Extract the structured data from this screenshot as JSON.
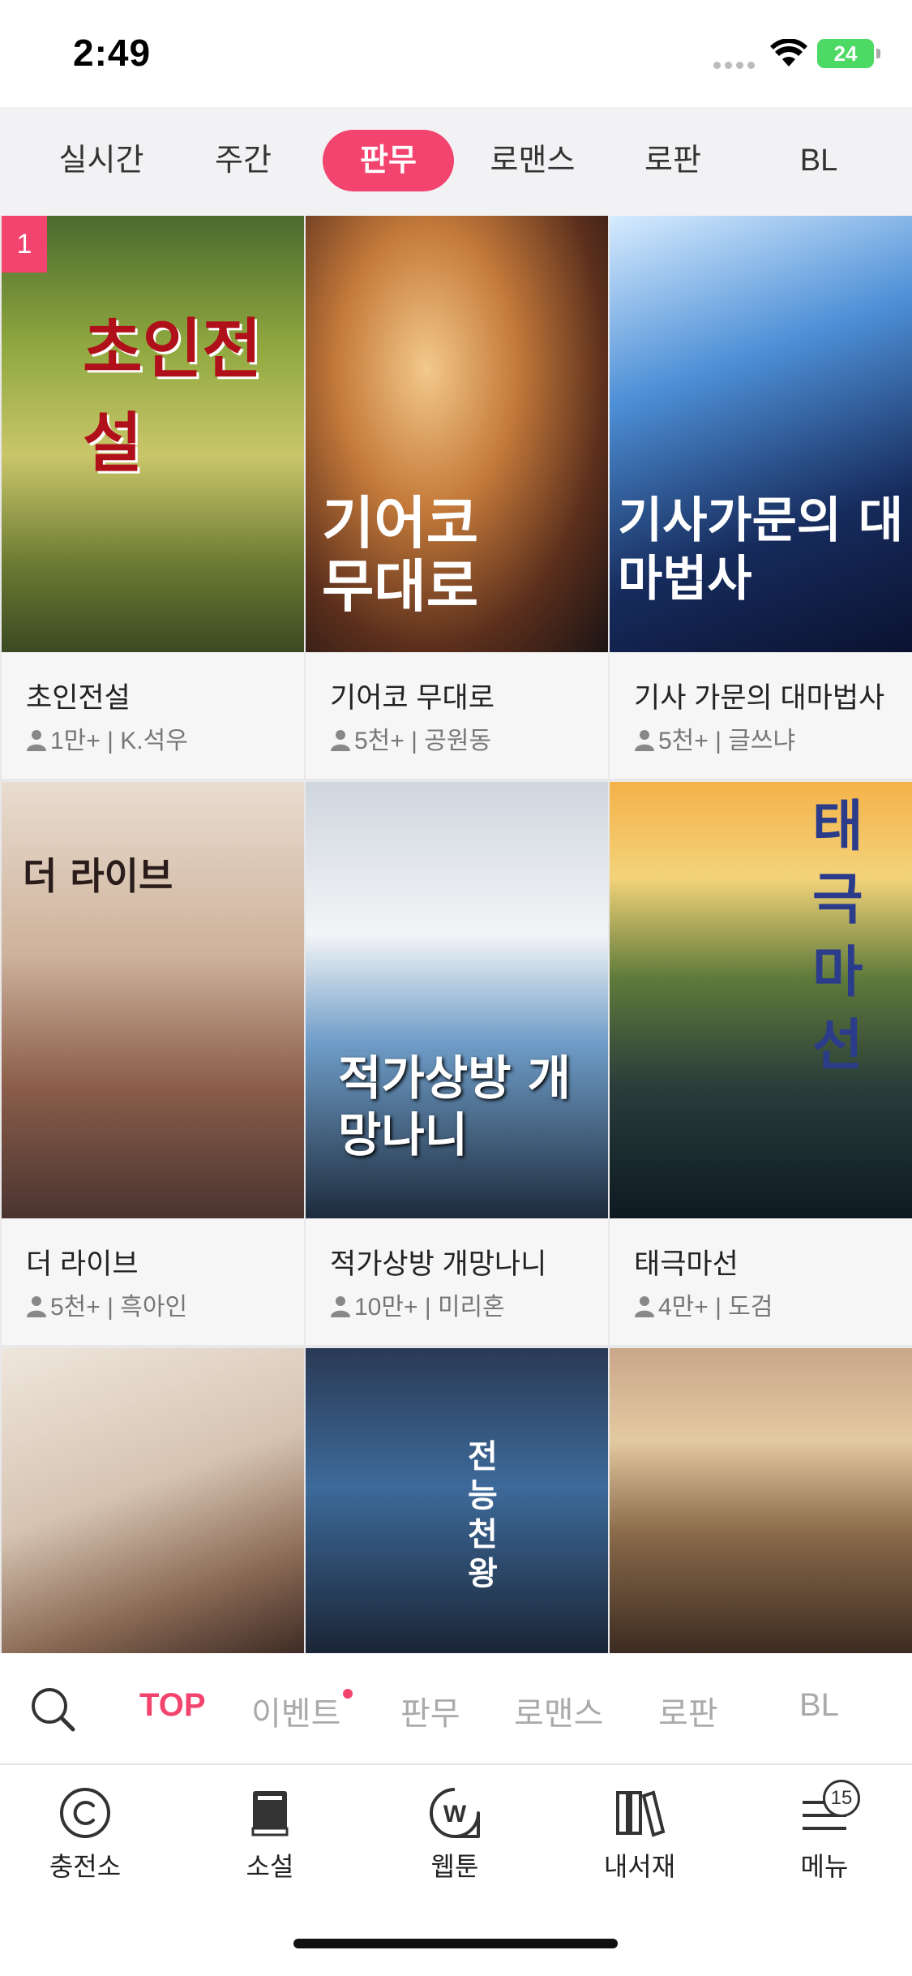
{
  "status_bar": {
    "time": "2:49",
    "battery": "24"
  },
  "category_tabs": [
    "실시간",
    "주간",
    "판무",
    "로맨스",
    "로판",
    "BL"
  ],
  "active_category": "판무",
  "books": [
    {
      "rank": "1",
      "cover_text": "초인전설",
      "title": "초인전설",
      "meta": "1만+ | K.석우"
    },
    {
      "cover_text": "기어코 무대로",
      "title": "기어코 무대로",
      "meta": "5천+ | 공원동"
    },
    {
      "cover_text": "기사가문의 대마법사",
      "title": "기사 가문의 대마법사",
      "meta": "5천+ | 글쓰냐"
    },
    {
      "cover_text": "더 라이브",
      "title": "더 라이브",
      "meta": "5천+ | 흑아인"
    },
    {
      "cover_text": "적가상방 개망나니",
      "title": "적가상방 개망나니",
      "meta": "10만+ | 미리혼"
    },
    {
      "cover_text": "태극마선",
      "title": "태극마선",
      "meta": "4만+ | 도검"
    },
    {
      "cover_text": "",
      "title": "",
      "meta": ""
    },
    {
      "cover_text": "전능천왕",
      "title": "",
      "meta": ""
    },
    {
      "cover_text": "",
      "title": "",
      "meta": ""
    }
  ],
  "sub_nav": [
    "TOP",
    "이벤트",
    "판무",
    "로맨스",
    "로판",
    "BL"
  ],
  "bottom_tabs": [
    {
      "label": "충전소",
      "icon": "coin-c-icon"
    },
    {
      "label": "소설",
      "icon": "book-icon"
    },
    {
      "label": "웹툰",
      "icon": "webtoon-w-icon"
    },
    {
      "label": "내서재",
      "icon": "library-icon"
    },
    {
      "label": "메뉴",
      "icon": "menu-icon",
      "badge": "15"
    }
  ]
}
